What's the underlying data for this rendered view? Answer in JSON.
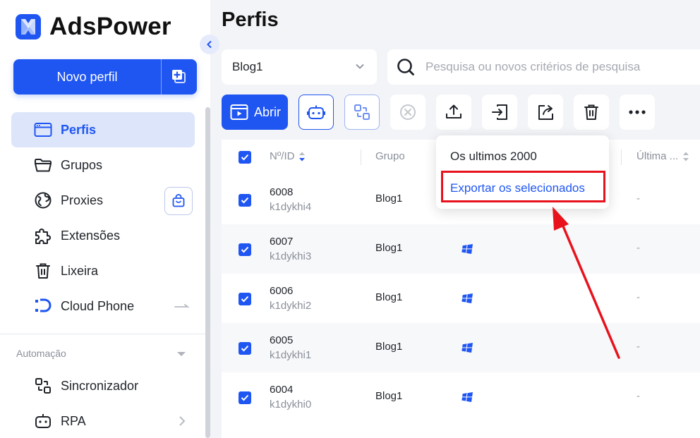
{
  "app": {
    "name": "AdsPower"
  },
  "sidebar": {
    "new_profile_label": "Novo perfil",
    "items": [
      {
        "label": "Perfis",
        "icon": "browser-window-icon",
        "active": true
      },
      {
        "label": "Grupos",
        "icon": "folder-icon"
      },
      {
        "label": "Proxies",
        "icon": "globe-icon"
      },
      {
        "label": "Extensões",
        "icon": "puzzle-icon"
      },
      {
        "label": "Lixeira",
        "icon": "trash-icon"
      },
      {
        "label": "Cloud Phone",
        "icon": "cloud-phone-icon"
      }
    ],
    "automation": {
      "title": "Automação",
      "items": [
        {
          "label": "Sincronizador",
          "icon": "sync-icon"
        },
        {
          "label": "RPA",
          "icon": "robot-icon"
        }
      ]
    }
  },
  "main": {
    "title": "Perfis",
    "group_select": {
      "value": "Blog1"
    },
    "search": {
      "placeholder": "Pesquisa ou novos critérios de pesquisa"
    },
    "toolbar": {
      "open_label": "Abrir",
      "icons": [
        "robot-icon",
        "sync-icon",
        "close-circle-icon",
        "upload-icon",
        "import-icon",
        "share-icon",
        "trash-icon",
        "more-icon"
      ]
    },
    "table": {
      "headers": {
        "id": "Nº/ID",
        "group": "Grupo",
        "last": "Última ..."
      },
      "rows": [
        {
          "num": "6008",
          "id": "k1dykhi4",
          "group": "Blog1",
          "os": "windows-icon",
          "last": "-"
        },
        {
          "num": "6007",
          "id": "k1dykhi3",
          "group": "Blog1",
          "os": "windows-icon",
          "last": "-"
        },
        {
          "num": "6006",
          "id": "k1dykhi2",
          "group": "Blog1",
          "os": "windows-icon",
          "last": "-"
        },
        {
          "num": "6005",
          "id": "k1dykhi1",
          "group": "Blog1",
          "os": "windows-icon",
          "last": "-"
        },
        {
          "num": "6004",
          "id": "k1dykhi0",
          "group": "Blog1",
          "os": "windows-icon",
          "last": "-"
        }
      ]
    },
    "export_menu": {
      "items": [
        {
          "label": "Os ultimos 2000"
        },
        {
          "label": "Exportar os selecionados",
          "highlighted": true
        }
      ]
    }
  },
  "colors": {
    "accent": "#1f56f2",
    "annotation": "#e8121c"
  }
}
